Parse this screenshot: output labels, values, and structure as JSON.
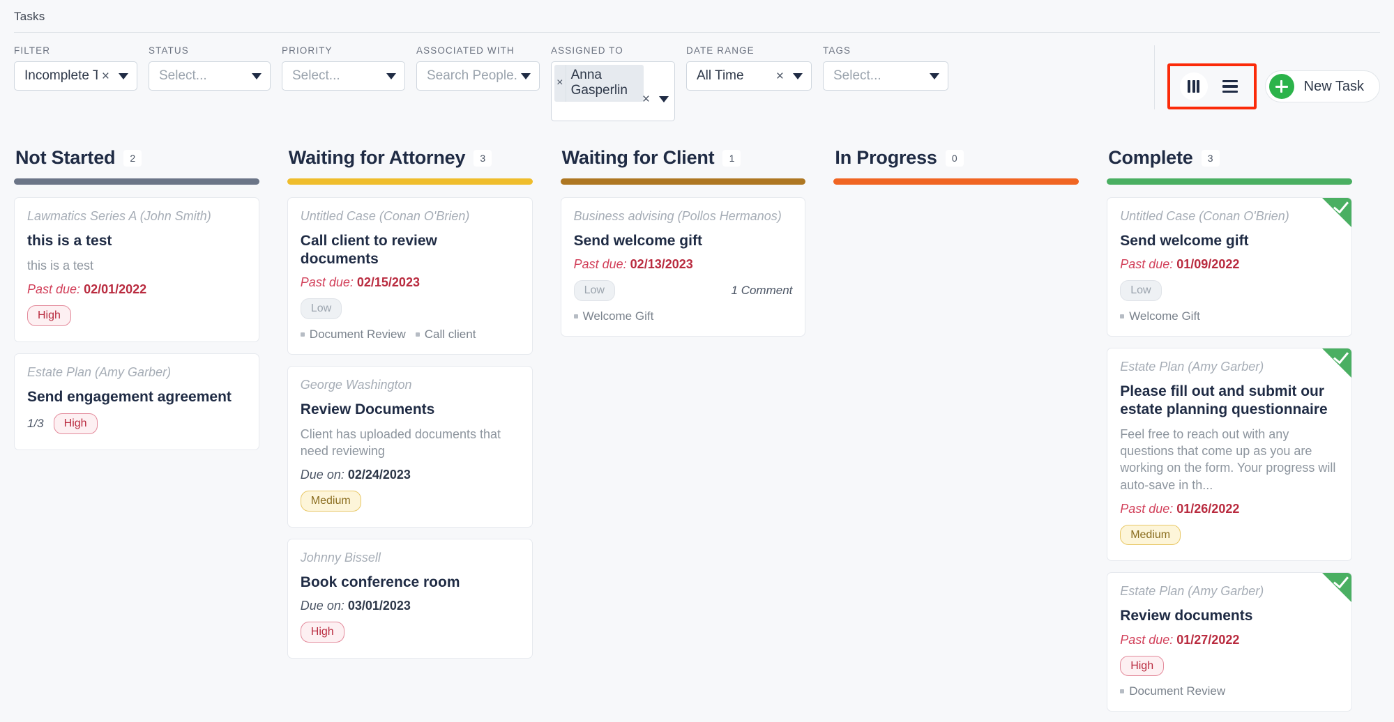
{
  "page": {
    "title": "Tasks"
  },
  "filters": [
    {
      "name": "filter",
      "label": "FILTER",
      "value": "Incomplete Ta...",
      "placeholder": "",
      "clearable": true,
      "width_class": "w-filter"
    },
    {
      "name": "status",
      "label": "STATUS",
      "value": "",
      "placeholder": "Select...",
      "clearable": false,
      "width_class": "w-status"
    },
    {
      "name": "priority",
      "label": "PRIORITY",
      "value": "",
      "placeholder": "Select...",
      "clearable": false,
      "width_class": "w-priority"
    },
    {
      "name": "associated-with",
      "label": "ASSOCIATED WITH",
      "value": "",
      "placeholder": "Search People...",
      "clearable": false,
      "width_class": "w-assoc"
    }
  ],
  "assigned_to": {
    "label": "ASSIGNED TO",
    "chip": "Anna Gasperlin",
    "chip_remove": "×",
    "clear": "×"
  },
  "filters_tail": [
    {
      "name": "date-range",
      "label": "DATE RANGE",
      "value": "All Time",
      "placeholder": "",
      "clearable": true,
      "width_class": "w-date"
    },
    {
      "name": "tags",
      "label": "TAGS",
      "value": "",
      "placeholder": "Select...",
      "clearable": false,
      "width_class": "w-tags"
    }
  ],
  "view_toggle": {
    "board_icon": "board-view-icon",
    "list_icon": "list-view-icon",
    "active": "board",
    "highlight_color": "#fb2a09"
  },
  "new_task": {
    "label": "New Task",
    "icon": "plus-icon",
    "color": "#2cb34a"
  },
  "columns": [
    {
      "title": "Not Started",
      "count": "2",
      "color": "#6b7587",
      "cards": [
        {
          "matter": "Lawmatics Series A (John Smith)",
          "title": "this is a test",
          "description": "this is a test",
          "due_label": "Past due:",
          "due_date": "02/01/2022",
          "due_state": "past",
          "priority": "High",
          "priority_class": "pill-high",
          "subtasks": "",
          "comments": "",
          "tags": [],
          "done": false
        },
        {
          "matter": "Estate Plan (Amy Garber)",
          "title": "Send engagement agreement",
          "description": "",
          "due_label": "",
          "due_date": "",
          "due_state": "none",
          "priority": "High",
          "priority_class": "pill-high",
          "subtasks": "1/3",
          "comments": "",
          "tags": [],
          "done": false
        }
      ]
    },
    {
      "title": "Waiting for Attorney",
      "count": "3",
      "color": "#efbd2c",
      "cards": [
        {
          "matter": "Untitled Case (Conan O'Brien)",
          "title": "Call client to review documents",
          "description": "",
          "due_label": "Past due:",
          "due_date": "02/15/2023",
          "due_state": "past",
          "priority": "Low",
          "priority_class": "pill-low",
          "subtasks": "",
          "comments": "",
          "tags": [
            "Document Review",
            "Call client"
          ],
          "done": false
        },
        {
          "matter": "George Washington",
          "title": "Review Documents",
          "description": "Client has uploaded documents that need reviewing",
          "due_label": "Due on:",
          "due_date": "02/24/2023",
          "due_state": "normal",
          "priority": "Medium",
          "priority_class": "pill-medium",
          "subtasks": "",
          "comments": "",
          "tags": [],
          "done": false
        },
        {
          "matter": "Johnny Bissell",
          "title": "Book conference room",
          "description": "",
          "due_label": "Due on:",
          "due_date": "03/01/2023",
          "due_state": "normal",
          "priority": "High",
          "priority_class": "pill-high",
          "subtasks": "",
          "comments": "",
          "tags": [],
          "done": false
        }
      ]
    },
    {
      "title": "Waiting for Client",
      "count": "1",
      "color": "#ae7722",
      "cards": [
        {
          "matter": "Business advising (Pollos Hermanos)",
          "title": "Send welcome gift",
          "description": "",
          "due_label": "Past due:",
          "due_date": "02/13/2023",
          "due_state": "past",
          "priority": "Low",
          "priority_class": "pill-low",
          "subtasks": "",
          "comments": "1 Comment",
          "tags": [
            "Welcome Gift"
          ],
          "done": false
        }
      ]
    },
    {
      "title": "In Progress",
      "count": "0",
      "color": "#f06522",
      "cards": []
    },
    {
      "title": "Complete",
      "count": "3",
      "color": "#4aaf62",
      "cards": [
        {
          "matter": "Untitled Case (Conan O'Brien)",
          "title": "Send welcome gift",
          "description": "",
          "due_label": "Past due:",
          "due_date": "01/09/2022",
          "due_state": "past",
          "priority": "Low",
          "priority_class": "pill-low",
          "subtasks": "",
          "comments": "",
          "tags": [
            "Welcome Gift"
          ],
          "done": true
        },
        {
          "matter": "Estate Plan (Amy Garber)",
          "title": "Please fill out and submit our estate planning questionnaire",
          "description": "Feel free to reach out with any questions that come up as you are working on the form. Your progress will auto-save in th...",
          "due_label": "Past due:",
          "due_date": "01/26/2022",
          "due_state": "past",
          "priority": "Medium",
          "priority_class": "pill-medium",
          "subtasks": "",
          "comments": "",
          "tags": [],
          "done": true
        },
        {
          "matter": "Estate Plan (Amy Garber)",
          "title": "Review documents",
          "description": "",
          "due_label": "Past due:",
          "due_date": "01/27/2022",
          "due_state": "past",
          "priority": "High",
          "priority_class": "pill-high",
          "subtasks": "",
          "comments": "",
          "tags": [
            "Document Review"
          ],
          "done": true
        }
      ]
    }
  ]
}
